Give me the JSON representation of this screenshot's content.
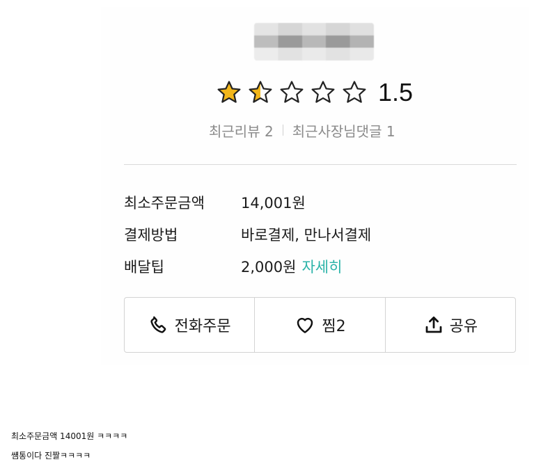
{
  "store": {
    "rating": 1.5,
    "rating_text": "1.5",
    "stars": [
      {
        "icon": "star-filled-icon",
        "fill": 1.0
      },
      {
        "icon": "star-half-icon",
        "fill": 0.5
      },
      {
        "icon": "star-empty-icon",
        "fill": 0.0
      },
      {
        "icon": "star-empty-icon",
        "fill": 0.0
      },
      {
        "icon": "star-empty-icon",
        "fill": 0.0
      }
    ],
    "recent_reviews": "최근리뷰 2",
    "recent_owner_replies": "최근사장님댓글 1"
  },
  "info": [
    {
      "label": "최소주문금액",
      "value": "14,001원"
    },
    {
      "label": "결제방법",
      "value": "바로결제, 만나서결제"
    },
    {
      "label": "배달팁",
      "value": "2,000원",
      "link": "자세히"
    }
  ],
  "actions": {
    "call": {
      "label": "전화주문",
      "icon": "phone-icon"
    },
    "like": {
      "label": "찜2",
      "icon": "heart-icon"
    },
    "share": {
      "label": "공유",
      "icon": "share-icon"
    }
  },
  "captions": [
    "최소주문금액 14001원 ㅋㅋㅋㅋ",
    "썜통이다 진짤ㅋㅋㅋㅋ"
  ],
  "colors": {
    "star": "#f2b619",
    "link": "#2bb3a8",
    "muted_text": "#8a8a8a",
    "border": "#d3d3d3"
  }
}
